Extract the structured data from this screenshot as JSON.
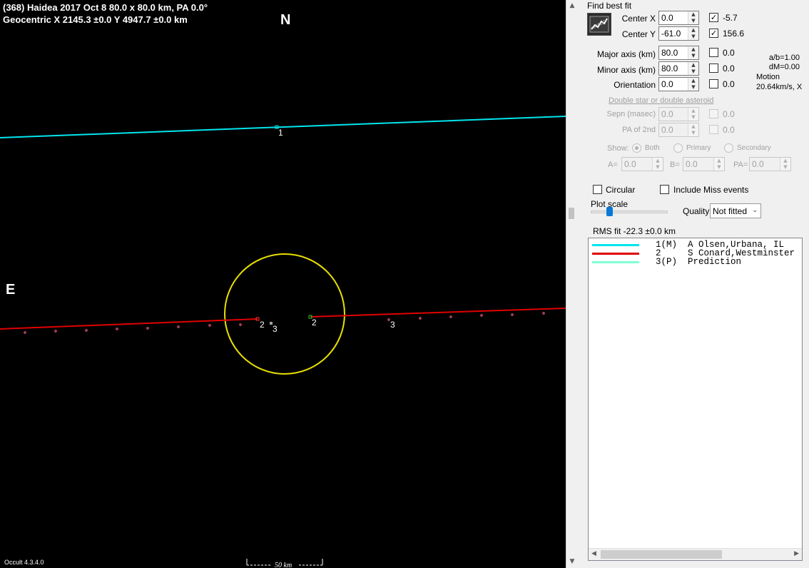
{
  "plot": {
    "header_line1": "(368) Haidea  2017 Oct 8   80.0 x 80.0 km,  PA 0.0°",
    "header_line2": "Geocentric  X  2145.3 ±0.0  Y 4947.7 ±0.0 km",
    "north_label": "N",
    "east_label": "E",
    "version": "Occult 4.3.4.0",
    "scale_bar_label": "50 km",
    "chord_labels": {
      "chord1": "1",
      "chord2_left": "2",
      "chord2_right": "2",
      "center3": "3",
      "right3": "3"
    },
    "colors": {
      "chord1": "#00e5ee",
      "chord2": "#e00000",
      "ellipse": "#e8e000",
      "background": "#000000"
    }
  },
  "panel": {
    "find_best_fit": "Find best fit",
    "center_x": {
      "label": "Center X",
      "value": "0.0",
      "checked": true,
      "fit": "-5.7"
    },
    "center_y": {
      "label": "Center Y",
      "value": "-61.0",
      "checked": true,
      "fit": "156.6"
    },
    "major_axis": {
      "label": "Major axis (km)",
      "value": "80.0",
      "checked": false,
      "fit": "0.0"
    },
    "minor_axis": {
      "label": "Minor axis (km)",
      "value": "80.0",
      "checked": false,
      "fit": "0.0"
    },
    "orientation": {
      "label": "Orientation",
      "value": "0.0",
      "checked": false,
      "fit": "0.0"
    },
    "ab_ratio": "a/b=1.00",
    "dm": "dM=0.00",
    "motion_label": "Motion",
    "motion_value": "20.64km/s, X",
    "double_star_link": "Double star  or  double asteroid",
    "sepn": {
      "label": "Sepn (masec)",
      "value": "0.0",
      "fit": "0.0"
    },
    "pa2nd": {
      "label": "PA of 2nd",
      "value": "0.0",
      "fit": "0.0"
    },
    "show_label": "Show:",
    "show_options": [
      "Both",
      "Primary",
      "Secondary"
    ],
    "a_field": {
      "label": "A=",
      "value": "0.0"
    },
    "b_field": {
      "label": "B=",
      "value": "0.0"
    },
    "pa_field": {
      "label": "PA=",
      "value": "0.0"
    },
    "circular_label": "Circular",
    "include_miss_label": "Include Miss events",
    "plot_scale_label": "Plot scale",
    "quality_label": "Quality",
    "quality_value": "Not fitted",
    "rms_fit": "RMS fit -22.3 ±0.0 km"
  },
  "legend": [
    {
      "text": "1(M)  A Olsen,Urbana, IL",
      "color": "#00e5ee"
    },
    {
      "text": "2     S Conard,Westminster",
      "color": "#e00000"
    },
    {
      "text": "3(P)  Prediction",
      "color": "#7fffd4"
    }
  ],
  "icons": {
    "fit_button": "chart-fit-icon",
    "scroll_up": "chevron-up-icon",
    "scroll_down": "chevron-down-icon"
  }
}
